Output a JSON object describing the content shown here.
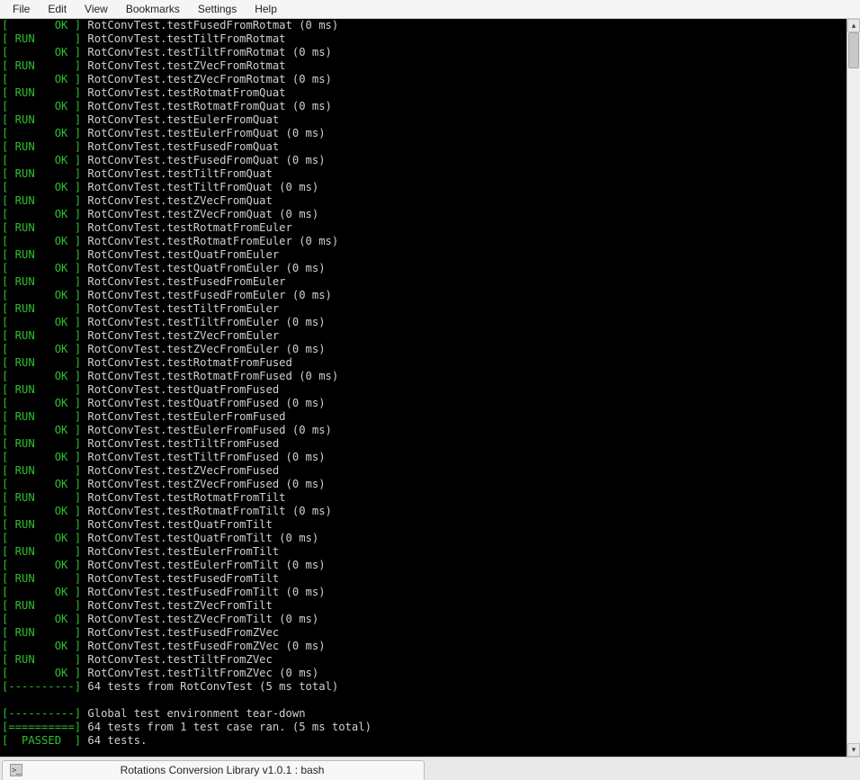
{
  "menubar": {
    "items": [
      "File",
      "Edit",
      "View",
      "Bookmarks",
      "Settings",
      "Help"
    ]
  },
  "terminal": {
    "lines": [
      {
        "kind": "ok",
        "text": "RotConvTest.testFusedFromRotmat (0 ms)"
      },
      {
        "kind": "run",
        "text": "RotConvTest.testTiltFromRotmat"
      },
      {
        "kind": "ok",
        "text": "RotConvTest.testTiltFromRotmat (0 ms)"
      },
      {
        "kind": "run",
        "text": "RotConvTest.testZVecFromRotmat"
      },
      {
        "kind": "ok",
        "text": "RotConvTest.testZVecFromRotmat (0 ms)"
      },
      {
        "kind": "run",
        "text": "RotConvTest.testRotmatFromQuat"
      },
      {
        "kind": "ok",
        "text": "RotConvTest.testRotmatFromQuat (0 ms)"
      },
      {
        "kind": "run",
        "text": "RotConvTest.testEulerFromQuat"
      },
      {
        "kind": "ok",
        "text": "RotConvTest.testEulerFromQuat (0 ms)"
      },
      {
        "kind": "run",
        "text": "RotConvTest.testFusedFromQuat"
      },
      {
        "kind": "ok",
        "text": "RotConvTest.testFusedFromQuat (0 ms)"
      },
      {
        "kind": "run",
        "text": "RotConvTest.testTiltFromQuat"
      },
      {
        "kind": "ok",
        "text": "RotConvTest.testTiltFromQuat (0 ms)"
      },
      {
        "kind": "run",
        "text": "RotConvTest.testZVecFromQuat"
      },
      {
        "kind": "ok",
        "text": "RotConvTest.testZVecFromQuat (0 ms)"
      },
      {
        "kind": "run",
        "text": "RotConvTest.testRotmatFromEuler"
      },
      {
        "kind": "ok",
        "text": "RotConvTest.testRotmatFromEuler (0 ms)"
      },
      {
        "kind": "run",
        "text": "RotConvTest.testQuatFromEuler"
      },
      {
        "kind": "ok",
        "text": "RotConvTest.testQuatFromEuler (0 ms)"
      },
      {
        "kind": "run",
        "text": "RotConvTest.testFusedFromEuler"
      },
      {
        "kind": "ok",
        "text": "RotConvTest.testFusedFromEuler (0 ms)"
      },
      {
        "kind": "run",
        "text": "RotConvTest.testTiltFromEuler"
      },
      {
        "kind": "ok",
        "text": "RotConvTest.testTiltFromEuler (0 ms)"
      },
      {
        "kind": "run",
        "text": "RotConvTest.testZVecFromEuler"
      },
      {
        "kind": "ok",
        "text": "RotConvTest.testZVecFromEuler (0 ms)"
      },
      {
        "kind": "run",
        "text": "RotConvTest.testRotmatFromFused"
      },
      {
        "kind": "ok",
        "text": "RotConvTest.testRotmatFromFused (0 ms)"
      },
      {
        "kind": "run",
        "text": "RotConvTest.testQuatFromFused"
      },
      {
        "kind": "ok",
        "text": "RotConvTest.testQuatFromFused (0 ms)"
      },
      {
        "kind": "run",
        "text": "RotConvTest.testEulerFromFused"
      },
      {
        "kind": "ok",
        "text": "RotConvTest.testEulerFromFused (0 ms)"
      },
      {
        "kind": "run",
        "text": "RotConvTest.testTiltFromFused"
      },
      {
        "kind": "ok",
        "text": "RotConvTest.testTiltFromFused (0 ms)"
      },
      {
        "kind": "run",
        "text": "RotConvTest.testZVecFromFused"
      },
      {
        "kind": "ok",
        "text": "RotConvTest.testZVecFromFused (0 ms)"
      },
      {
        "kind": "run",
        "text": "RotConvTest.testRotmatFromTilt"
      },
      {
        "kind": "ok",
        "text": "RotConvTest.testRotmatFromTilt (0 ms)"
      },
      {
        "kind": "run",
        "text": "RotConvTest.testQuatFromTilt"
      },
      {
        "kind": "ok",
        "text": "RotConvTest.testQuatFromTilt (0 ms)"
      },
      {
        "kind": "run",
        "text": "RotConvTest.testEulerFromTilt"
      },
      {
        "kind": "ok",
        "text": "RotConvTest.testEulerFromTilt (0 ms)"
      },
      {
        "kind": "run",
        "text": "RotConvTest.testFusedFromTilt"
      },
      {
        "kind": "ok",
        "text": "RotConvTest.testFusedFromTilt (0 ms)"
      },
      {
        "kind": "run",
        "text": "RotConvTest.testZVecFromTilt"
      },
      {
        "kind": "ok",
        "text": "RotConvTest.testZVecFromTilt (0 ms)"
      },
      {
        "kind": "run",
        "text": "RotConvTest.testFusedFromZVec"
      },
      {
        "kind": "ok",
        "text": "RotConvTest.testFusedFromZVec (0 ms)"
      },
      {
        "kind": "run",
        "text": "RotConvTest.testTiltFromZVec"
      },
      {
        "kind": "ok",
        "text": "RotConvTest.testTiltFromZVec (0 ms)"
      },
      {
        "kind": "sep",
        "text": "64 tests from RotConvTest (5 ms total)"
      },
      {
        "kind": "blank",
        "text": ""
      },
      {
        "kind": "sep",
        "text": "Global test environment tear-down"
      },
      {
        "kind": "eq",
        "text": "64 tests from 1 test case ran. (5 ms total)"
      },
      {
        "kind": "pass",
        "text": "64 tests."
      }
    ],
    "tags": {
      "ok": "[       OK ]",
      "run": "[ RUN      ]",
      "sep": "[----------]",
      "eq": "[==========]",
      "pass": "[  PASSED  ]"
    }
  },
  "statusbar": {
    "tab_title": "Rotations Conversion Library v1.0.1 : bash",
    "tab_icon": ">_"
  }
}
